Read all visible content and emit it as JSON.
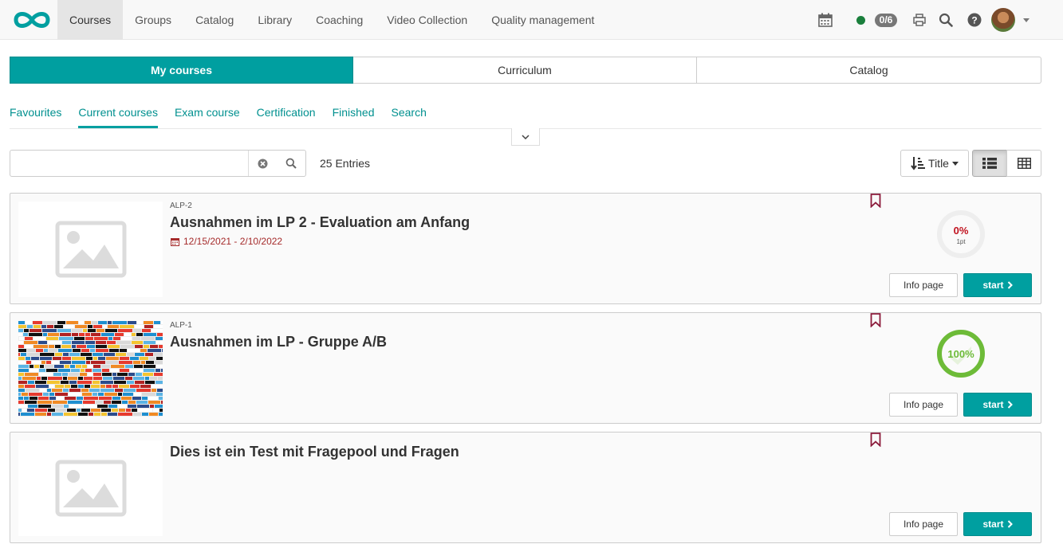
{
  "nav": {
    "items": [
      {
        "label": "Courses",
        "active": true
      },
      {
        "label": "Groups"
      },
      {
        "label": "Catalog"
      },
      {
        "label": "Library"
      },
      {
        "label": "Coaching"
      },
      {
        "label": "Video Collection"
      },
      {
        "label": "Quality management"
      }
    ],
    "badge": "0/6",
    "icons": [
      "calendar-icon",
      "status-dot",
      "print-icon",
      "search-icon",
      "help-icon",
      "avatar"
    ]
  },
  "main_tabs": [
    {
      "label": "My courses",
      "active": true
    },
    {
      "label": "Curriculum"
    },
    {
      "label": "Catalog"
    }
  ],
  "subnav": [
    {
      "label": "Favourites"
    },
    {
      "label": "Current courses",
      "active": true
    },
    {
      "label": "Exam course"
    },
    {
      "label": "Certification"
    },
    {
      "label": "Finished"
    },
    {
      "label": "Search"
    }
  ],
  "search": {
    "value": "",
    "placeholder": ""
  },
  "entries": "25 Entries",
  "sort": {
    "label": "Title"
  },
  "colors": {
    "accent": "#009fa0",
    "date": "#a52a2a",
    "bookmark": "#8b1a3a",
    "progress_done": "#6dbb38",
    "progress_zero": "#c1121f"
  },
  "courses": [
    {
      "ref": "ALP-2",
      "title": "Ausnahmen im LP 2 - Evaluation am Anfang",
      "dates": "12/15/2021 - 2/10/2022",
      "progress": {
        "percent": 0,
        "label": "0%",
        "sub": "1pt"
      },
      "info_label": "Info page",
      "start_label": "start"
    },
    {
      "ref": "ALP-1",
      "title": "Ausnahmen im LP - Gruppe A/B",
      "dates": "",
      "progress": {
        "percent": 100,
        "label": "100%",
        "sub": ""
      },
      "info_label": "Info page",
      "start_label": "start"
    },
    {
      "ref": "",
      "title": "Dies ist ein Test mit Fragepool und Fragen",
      "dates": "",
      "progress": null,
      "info_label": "Info page",
      "start_label": "start"
    }
  ]
}
